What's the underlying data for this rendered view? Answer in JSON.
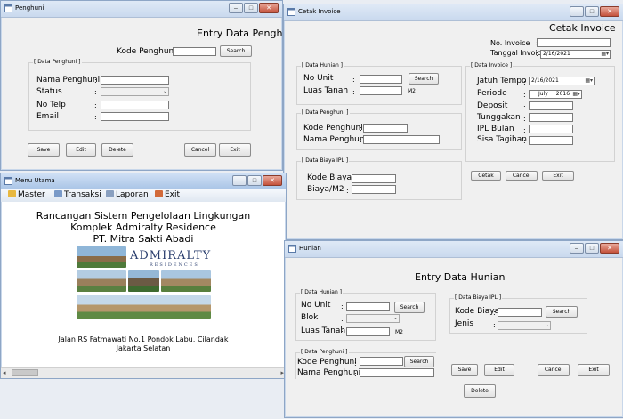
{
  "penghuni": {
    "title": "Penghuni",
    "heading": "Entry Data Penghuni",
    "kode_label": "Kode Penghuni",
    "search_btn": "Search",
    "group_label": "[ Data Penghuni ]",
    "nama_label": "Nama Penghuni",
    "status_label": "Status",
    "notelp_label": "No Telp",
    "email_label": "Email",
    "colon": ":",
    "buttons": {
      "save": "Save",
      "edit": "Edit",
      "delete": "Delete",
      "cancel": "Cancel",
      "exit": "Exit"
    }
  },
  "invoice": {
    "title": "Cetak Invoice",
    "heading": "Cetak Invoice",
    "no_invoice_label": "No. Invoice",
    "tanggal_label": "Tanggal Invoice",
    "tanggal_value": "2/16/2021",
    "hunian_group": "[ Data Hunian ]",
    "no_unit_label": "No Unit",
    "search_btn": "Search",
    "luas_label": "Luas Tanah",
    "m2": "M2",
    "penghuni_group": "[ Data Penghuni ]",
    "kode_penghuni_label": "Kode Penghuni",
    "nama_penghuni_label": "Nama Penghuni",
    "biaya_group": "[ Data Biaya IPL ]",
    "kode_biaya_label": "Kode Biaya",
    "biaya_m2_label": "Biaya/M2",
    "inv_group": "[ Data Invoice ]",
    "jatuh_tempo_label": "Jatuh Tempo",
    "jatuh_tempo_value": "2/16/2021",
    "periode_label": "Periode",
    "periode_month": "July",
    "periode_year": "2016",
    "deposit_label": "Deposit",
    "tunggakan_label": "Tunggakan",
    "ipl_bulan_label": "IPL Bulan",
    "sisa_label": "Sisa Tagihan",
    "buttons": {
      "cetak": "Cetak",
      "cancel": "Cancel",
      "exit": "Exit"
    }
  },
  "menu": {
    "title": "Menu Utama",
    "items": [
      "Master",
      "Transaksi",
      "Laporan",
      "Exit"
    ],
    "line1": "Rancangan Sistem Pengelolaan Lingkungan",
    "line2": "Komplek Admiralty Residence",
    "line3": "PT. Mitra Sakti Abadi",
    "logo_text": "ADMIRALTY",
    "logo_sub": "RESIDENCES",
    "address1": "Jalan RS Fatmawati No.1 Pondok Labu, Cilandak",
    "address2": "Jakarta Selatan"
  },
  "hunian": {
    "title": "Hunian",
    "heading": "Entry Data Hunian",
    "hunian_group": "[ Data Hunian ]",
    "no_unit_label": "No Unit",
    "blok_label": "Blok",
    "luas_label": "Luas Tanah",
    "m2": "M2",
    "search_btn": "Search",
    "penghuni_group": "[ Data Penghuni ]",
    "kode_penghuni_label": "Kode Penghuni",
    "nama_penghuni_label": "Nama Penghuni",
    "biaya_group": "[ Data Biaya IPL ]",
    "kode_biaya_label": "Kode Biaya",
    "jenis_label": "Jenis",
    "buttons": {
      "save": "Save",
      "edit": "Edit",
      "cancel": "Cancel",
      "exit": "Exit",
      "delete": "Delete"
    }
  },
  "window_buttons": {
    "minimize": "–",
    "maximize": "□",
    "close": "✕"
  }
}
